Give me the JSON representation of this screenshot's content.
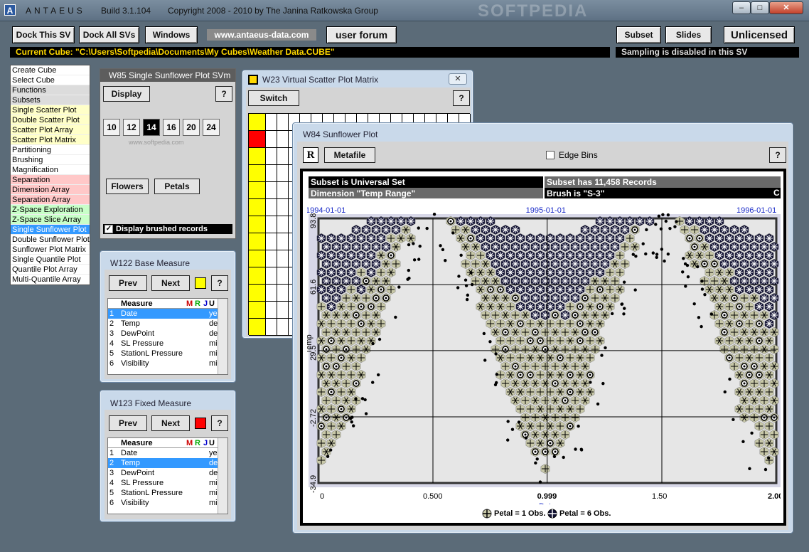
{
  "titlebar": {
    "app_name": "ANTAEUS",
    "build": "Build 3.1.104",
    "copyright": "Copyright 2008 - 2010 by The Janina Ratkowska Group",
    "watermark": "SOFTPEDIA",
    "minimize": "–",
    "maximize": "□",
    "close": "✕"
  },
  "toolbar": {
    "dock_this": "Dock This SV",
    "dock_all": "Dock All SVs",
    "windows": "Windows",
    "url": "www.antaeus-data.com",
    "forum": "user forum",
    "subset": "Subset",
    "slides": "Slides",
    "license": "Unlicensed",
    "current_cube": "Current Cube: \"C:\\Users\\Softpedia\\Documents\\My Cubes\\Weather Data.CUBE\"",
    "sampling": "Sampling is disabled in this SV"
  },
  "menu": [
    {
      "label": "Create Cube",
      "bg": "#ffffff"
    },
    {
      "label": "Select Cube",
      "bg": "#ffffff"
    },
    {
      "label": "Functions",
      "bg": "#dcdcdc"
    },
    {
      "label": "Subsets",
      "bg": "#dcdcdc"
    },
    {
      "label": "Single Scatter Plot",
      "bg": "#ffffc8"
    },
    {
      "label": "Double Scatter Plot",
      "bg": "#ffffc8"
    },
    {
      "label": "Scatter Plot Array",
      "bg": "#ffffc8"
    },
    {
      "label": "Scatter Plot Matrix",
      "bg": "#ffffc8"
    },
    {
      "label": "Partitioning",
      "bg": "#ffffff"
    },
    {
      "label": "Brushing",
      "bg": "#ffffff"
    },
    {
      "label": "Magnification",
      "bg": "#ffffff"
    },
    {
      "label": "Separation",
      "bg": "#ffc8c8"
    },
    {
      "label": "Dimension Array",
      "bg": "#ffc8c8"
    },
    {
      "label": "Separation Array",
      "bg": "#ffc8c8"
    },
    {
      "label": "Z-Space Exploration",
      "bg": "#c8ffc8"
    },
    {
      "label": "Z-Space Slice Array",
      "bg": "#c8ffc8"
    },
    {
      "label": "Single Sunflower Plot",
      "bg": "#3399ff",
      "selected": true
    },
    {
      "label": "Double Sunflower Plot",
      "bg": "#ffffff"
    },
    {
      "label": "Sunflower Plot Matrix",
      "bg": "#ffffff"
    },
    {
      "label": "Single Quantile Plot",
      "bg": "#ffffff"
    },
    {
      "label": "Quantile Plot Array",
      "bg": "#ffffff"
    },
    {
      "label": "Multi-Quantile Array",
      "bg": "#ffffff"
    }
  ],
  "w85": {
    "title": "W85  Single Sunflower Plot SVm",
    "display": "Display",
    "help": "?",
    "sizes": [
      "10",
      "12",
      "14",
      "16",
      "20",
      "24"
    ],
    "selected_size": "14",
    "watermark": "www.softpedia.com",
    "flowers": "Flowers",
    "petals": "Petals",
    "display_brushed": "Display brushed records",
    "checked": "✓"
  },
  "w122": {
    "title": "W122  Base Measure",
    "prev": "Prev",
    "next": "Next",
    "help": "?",
    "swatch": "#ffff00",
    "headers": {
      "measure": "Measure",
      "m": "M",
      "r": "R",
      "j": "J",
      "u": "U"
    },
    "rows": [
      {
        "n": "1",
        "name": "Date",
        "u": "ye",
        "sel": true
      },
      {
        "n": "2",
        "name": "Temp",
        "u": "de"
      },
      {
        "n": "3",
        "name": "DewPoint",
        "u": "de"
      },
      {
        "n": "4",
        "name": "SL Pressure",
        "u": "mi"
      },
      {
        "n": "5",
        "name": "StationL Pressure",
        "u": "mi"
      },
      {
        "n": "6",
        "name": "Visibility",
        "u": "mi"
      }
    ]
  },
  "w123": {
    "title": "W123   Fixed Measure",
    "prev": "Prev",
    "next": "Next",
    "help": "?",
    "swatch": "#ff0000",
    "headers": {
      "measure": "Measure",
      "m": "M",
      "r": "R",
      "j": "J",
      "u": "U"
    },
    "rows": [
      {
        "n": "1",
        "name": "Date",
        "u": "ye"
      },
      {
        "n": "2",
        "name": "Temp",
        "u": "de",
        "sel": true
      },
      {
        "n": "3",
        "name": "DewPoint",
        "u": "de"
      },
      {
        "n": "4",
        "name": "SL Pressure",
        "u": "mi"
      },
      {
        "n": "5",
        "name": "StationL Pressure",
        "u": "mi"
      },
      {
        "n": "6",
        "name": "Visibility",
        "u": "mi"
      }
    ]
  },
  "w23": {
    "title": "W23  Virtual Scatter Plot Matrix",
    "switch": "Switch",
    "help": "?",
    "close": "✕",
    "first_col_colors": [
      "#ffff00",
      "#ff0000",
      "#ffff00",
      "#ffff00",
      "#ffff00",
      "#ffff00",
      "#ffff00",
      "#ffff00",
      "#ffff00",
      "#ffff00",
      "#ffff00",
      "#ffff00",
      "#ffff00"
    ]
  },
  "w84": {
    "title": "W84  Sunflower Plot",
    "r": "R",
    "metafile": "Metafile",
    "edge_bins": "Edge Bins",
    "help": "?",
    "info": {
      "subset": "Subset is Universal Set",
      "records": "Subset has 11,458 Records",
      "dimension": "Dimension \"Temp Range\"",
      "brush": "Brush is \"S-3\"",
      "brush_tag": "C"
    },
    "legend_1": "Petal = 1 Obs.",
    "legend_6": "Petal = 6 Obs."
  },
  "chart_data": {
    "type": "scatter",
    "xlabel": "Date",
    "ylabel": "Temp",
    "x_ticks": [
      "0",
      "0.500",
      "0.999",
      "1.50",
      "2.00"
    ],
    "x_tick_values": [
      0,
      0.5,
      0.999,
      1.5,
      2.0
    ],
    "top_ticks": [
      "1994-01-01",
      "1995-01-01",
      "1996-01-01"
    ],
    "y_ticks": [
      "93.8",
      "61.6",
      "29.5",
      "-2.72",
      "-34.9"
    ],
    "y_tick_values": [
      93.8,
      61.6,
      29.5,
      -2.72,
      -34.9
    ],
    "xlim": [
      0,
      2.0
    ],
    "ylim": [
      -34.9,
      93.8
    ],
    "grid": true,
    "colors": {
      "dense": "#111133",
      "medium": "#c8c8a8",
      "sparse": "#000000",
      "bg": "#e6e6e6"
    }
  }
}
